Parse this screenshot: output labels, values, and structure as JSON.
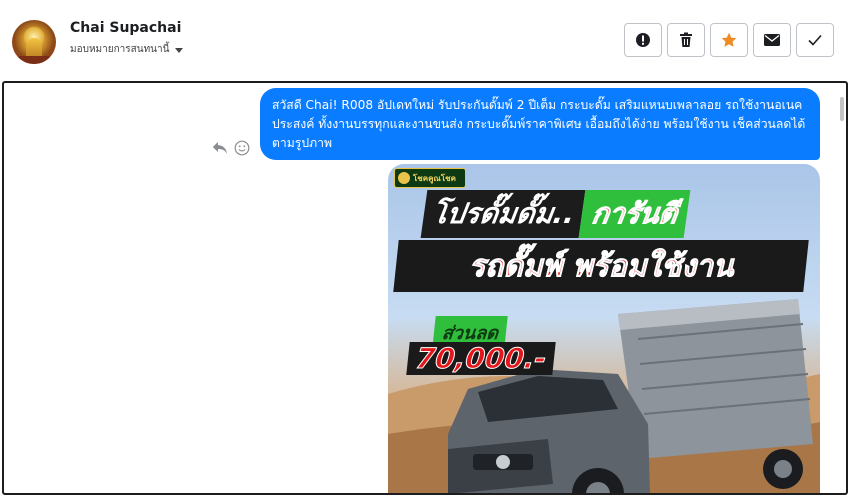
{
  "header": {
    "contact_name": "Chai Supachai",
    "assign_label": "มอบหมายการสนทนานี้"
  },
  "actions": [
    {
      "name": "mark-spam-button",
      "icon": "alert-circle-icon"
    },
    {
      "name": "delete-button",
      "icon": "trash-icon"
    },
    {
      "name": "star-button",
      "icon": "star-icon"
    },
    {
      "name": "mark-unread-button",
      "icon": "envelope-icon"
    },
    {
      "name": "mark-done-button",
      "icon": "check-icon"
    }
  ],
  "colors": {
    "bubble": "#0a7cff",
    "star": "#f08a24",
    "panel_border": "#1d1d1d"
  },
  "message": {
    "text": "สวัสดี Chai!  R008 อัปเดทใหม่ รับประกันดั๊มพ์ 2 ปีเต็ม กระบะดั๊ม เสริมแหนบเพลาลอย รถใช้งานอเนคประสงค์ ทั้งงานบรรทุกและงานขนส่ง กระบะดั๊มพ์ราคาพิเศษ เอื้อมถึงได้ง่าย พร้อมใช้งาน เช็คส่วนลดได้ตามรูปภาพ"
  },
  "attachment": {
    "logo_text": "โชคคูณโชค",
    "headline_1a": "โปรดั๊มดั๊ม..",
    "headline_1b": "การันตี",
    "headline_2": "รถดั๊มพ์ พร้อมใช้งาน",
    "discount_label": "ส่วนลด",
    "discount_value": "70,000.-"
  }
}
